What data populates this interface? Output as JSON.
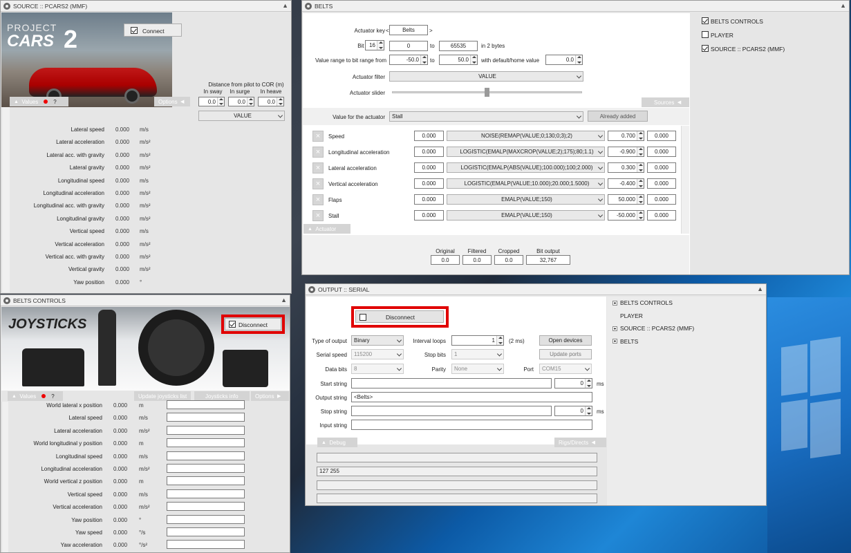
{
  "source_window": {
    "title": "SOURCE :: PCARS2 (MMF)",
    "logo_project": "PROJECT",
    "logo_cars": "CARS",
    "logo_num": "2",
    "connect_label": "Connect",
    "cor_title": "Distance from pilot to COR (m)",
    "cor_cols": [
      "In sway",
      "In surge",
      "In heave"
    ],
    "cor_values": [
      "0.0",
      "0.0",
      "0.0"
    ],
    "value_combo": "VALUE",
    "values_tab": "Values",
    "help": "?",
    "options_tab": "Options",
    "rows": [
      {
        "label": "Lateral speed",
        "value": "0.000",
        "unit": "m/s"
      },
      {
        "label": "Lateral acceleration",
        "value": "0.000",
        "unit": "m/s²"
      },
      {
        "label": "Lateral acc. with gravity",
        "value": "0.000",
        "unit": "m/s²"
      },
      {
        "label": "Lateral gravity",
        "value": "0.000",
        "unit": "m/s²"
      },
      {
        "label": "Longitudinal speed",
        "value": "0.000",
        "unit": "m/s"
      },
      {
        "label": "Longitudinal acceleration",
        "value": "0.000",
        "unit": "m/s²"
      },
      {
        "label": "Longitudinal acc. with gravity",
        "value": "0.000",
        "unit": "m/s²"
      },
      {
        "label": "Longitudinal gravity",
        "value": "0.000",
        "unit": "m/s²"
      },
      {
        "label": "Vertical speed",
        "value": "0.000",
        "unit": "m/s"
      },
      {
        "label": "Vertical acceleration",
        "value": "0.000",
        "unit": "m/s²"
      },
      {
        "label": "Vertical acc. with gravity",
        "value": "0.000",
        "unit": "m/s²"
      },
      {
        "label": "Vertical gravity",
        "value": "0.000",
        "unit": "m/s²"
      },
      {
        "label": "Yaw position",
        "value": "0.000",
        "unit": "°"
      }
    ]
  },
  "belts_controls_window": {
    "title": "BELTS CONTROLS",
    "banner": "JOYSTICKS",
    "disconnect_label": "Disconnect",
    "values_tab": "Values",
    "help": "?",
    "update_list": "Update joysticks list",
    "joysticks_info": "Joysticks info",
    "options_tab": "Options",
    "rows": [
      {
        "label": "World lateral x position",
        "value": "0.000",
        "unit": "m"
      },
      {
        "label": "Lateral speed",
        "value": "0.000",
        "unit": "m/s"
      },
      {
        "label": "Lateral acceleration",
        "value": "0.000",
        "unit": "m/s²"
      },
      {
        "label": "World longitudinal y position",
        "value": "0.000",
        "unit": "m"
      },
      {
        "label": "Longitudinal speed",
        "value": "0.000",
        "unit": "m/s"
      },
      {
        "label": "Longitudinal acceleration",
        "value": "0.000",
        "unit": "m/s²"
      },
      {
        "label": "World vertical z position",
        "value": "0.000",
        "unit": "m"
      },
      {
        "label": "Vertical speed",
        "value": "0.000",
        "unit": "m/s"
      },
      {
        "label": "Vertical acceleration",
        "value": "0.000",
        "unit": "m/s²"
      },
      {
        "label": "Yaw position",
        "value": "0.000",
        "unit": "°"
      },
      {
        "label": "Yaw speed",
        "value": "0.000",
        "unit": "°/s"
      },
      {
        "label": "Yaw acceleration",
        "value": "0.000",
        "unit": "°/s²"
      }
    ]
  },
  "belts_window": {
    "title": "BELTS",
    "actuator_key_label": "Actuator key",
    "lt": "<",
    "gt": ">",
    "actuator_key": "Belts",
    "bit_output_label": "Bit output",
    "bit_output": "16",
    "bit_from": "0",
    "to": "to",
    "bit_to": "65535",
    "bytes_label": "in 2 bytes",
    "value_range_label": "Value range to bit range from",
    "range_from": "-50.0",
    "range_to": "50.0",
    "default_label": "with default/home value",
    "default_value": "0.0",
    "filter_label": "Actuator filter",
    "filter_value": "VALUE",
    "slider_label": "Actuator slider",
    "sources_tab": "Sources",
    "value_for_label": "Value for the actuator",
    "value_for": "Stall",
    "already_added": "Already added",
    "x": "×",
    "rows": [
      {
        "name": "Speed",
        "in": "0.000",
        "formula": "NOISE(REMAP(VALUE;0;130;0;3);2)",
        "gain": "0.700",
        "out": "0.000"
      },
      {
        "name": "Longitudinal acceleration",
        "in": "0.000",
        "formula": "LOGISTIC(EMALP(MAXCROP(VALUE;2);175);80;1.1)",
        "gain": "-0.900",
        "out": "0.000"
      },
      {
        "name": "Lateral acceleration",
        "in": "0.000",
        "formula": "LOGISTIC(EMALP(ABS(VALUE);100.000);100;2.000)",
        "gain": "0.300",
        "out": "0.000"
      },
      {
        "name": "Vertical acceleration",
        "in": "0.000",
        "formula": "LOGISTIC(EMALP(VALUE;10.000);20.000;1.5000)",
        "gain": "-0.400",
        "out": "0.000"
      },
      {
        "name": "Flaps",
        "in": "0.000",
        "formula": "EMALP(VALUE;150)",
        "gain": "50.000",
        "out": "0.000"
      },
      {
        "name": "Stall",
        "in": "0.000",
        "formula": "EMALP(VALUE;150)",
        "gain": "-50.000",
        "out": "0.000"
      }
    ],
    "actuator_tab": "Actuator",
    "footer_labels": [
      "Original",
      "Filtered",
      "Cropped",
      "Bit output"
    ],
    "footer_values": [
      "0.0",
      "0.0",
      "0.0",
      "32,767"
    ],
    "side_items": [
      {
        "label": "BELTS CONTROLS",
        "checked": true
      },
      {
        "label": "PLAYER",
        "checked": false
      },
      {
        "label": "SOURCE :: PCARS2 (MMF)",
        "checked": true
      }
    ]
  },
  "output_window": {
    "title": "OUTPUT :: SERIAL",
    "disconnect_label": "Disconnect",
    "type_label": "Type of output",
    "type_value": "Binary",
    "interval_label": "Interval loops",
    "interval_value": "1",
    "interval_unit": "(2 ms)",
    "open_devices": "Open devices",
    "speed_label": "Serial speed",
    "speed_value": "115200",
    "stop_bits_label": "Stop bits",
    "stop_bits_value": "1",
    "update_ports": "Update ports",
    "data_bits_label": "Data bits",
    "data_bits_value": "8",
    "parity_label": "Parity",
    "parity_value": "None",
    "port_label": "Port",
    "port_value": "COM15",
    "start_label": "Start string",
    "start_delay": "0",
    "ms": "ms",
    "output_label": "Output string",
    "output_value": "<Belts>",
    "stop_label": "Stop string",
    "stop_delay": "0",
    "input_label": "Input string",
    "debug_tab": "Debug",
    "rigs_tab": "Rigs/Directs",
    "debug_line": "127 255",
    "tree": [
      {
        "label": "BELTS CONTROLS",
        "expand": true
      },
      {
        "label": "PLAYER",
        "expand": false
      },
      {
        "label": "SOURCE :: PCARS2 (MMF)",
        "expand": true
      },
      {
        "label": "BELTS",
        "expand": true
      }
    ]
  }
}
